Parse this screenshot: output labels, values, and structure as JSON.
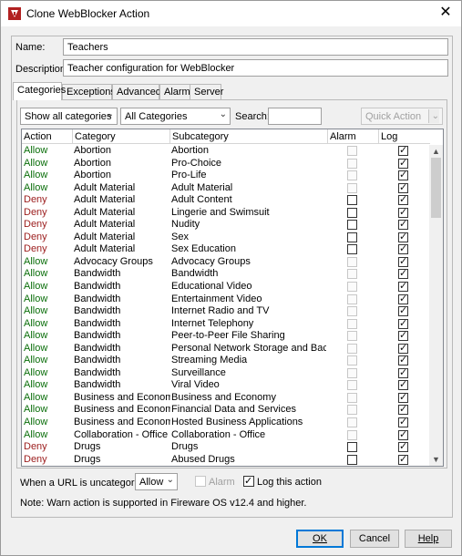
{
  "window": {
    "title": "Clone WebBlocker Action",
    "close_label": "✕"
  },
  "form": {
    "name_label": "Name:",
    "name_value": "Teachers",
    "description_label": "Description:",
    "description_value": "Teacher configuration for WebBlocker"
  },
  "tabs": [
    {
      "label": "Categories",
      "active": true
    },
    {
      "label": "Exceptions",
      "active": false
    },
    {
      "label": "Advanced",
      "active": false
    },
    {
      "label": "Alarm",
      "active": false
    },
    {
      "label": "Server",
      "active": false
    }
  ],
  "filters": {
    "show_select": "Show all categories",
    "category_select": "All Categories",
    "search_label": "Search:",
    "search_value": "",
    "quick_action": "Quick Action"
  },
  "table": {
    "headers": {
      "action": "Action",
      "category": "Category",
      "subcategory": "Subcategory",
      "alarm": "Alarm",
      "log": "Log"
    },
    "rows": [
      {
        "action": "Allow",
        "category": "Abortion",
        "subcategory": "Abortion",
        "alarm_enabled": false,
        "alarm": false,
        "log": true
      },
      {
        "action": "Allow",
        "category": "Abortion",
        "subcategory": "Pro-Choice",
        "alarm_enabled": false,
        "alarm": false,
        "log": true
      },
      {
        "action": "Allow",
        "category": "Abortion",
        "subcategory": "Pro-Life",
        "alarm_enabled": false,
        "alarm": false,
        "log": true
      },
      {
        "action": "Allow",
        "category": "Adult Material",
        "subcategory": "Adult Material",
        "alarm_enabled": false,
        "alarm": false,
        "log": true
      },
      {
        "action": "Deny",
        "category": "Adult Material",
        "subcategory": "Adult Content",
        "alarm_enabled": true,
        "alarm": false,
        "log": true
      },
      {
        "action": "Deny",
        "category": "Adult Material",
        "subcategory": "Lingerie and Swimsuit",
        "alarm_enabled": true,
        "alarm": false,
        "log": true
      },
      {
        "action": "Deny",
        "category": "Adult Material",
        "subcategory": "Nudity",
        "alarm_enabled": true,
        "alarm": false,
        "log": true
      },
      {
        "action": "Deny",
        "category": "Adult Material",
        "subcategory": "Sex",
        "alarm_enabled": true,
        "alarm": false,
        "log": true
      },
      {
        "action": "Deny",
        "category": "Adult Material",
        "subcategory": "Sex Education",
        "alarm_enabled": true,
        "alarm": false,
        "log": true
      },
      {
        "action": "Allow",
        "category": "Advocacy Groups",
        "subcategory": "Advocacy Groups",
        "alarm_enabled": false,
        "alarm": false,
        "log": true
      },
      {
        "action": "Allow",
        "category": "Bandwidth",
        "subcategory": "Bandwidth",
        "alarm_enabled": false,
        "alarm": false,
        "log": true
      },
      {
        "action": "Allow",
        "category": "Bandwidth",
        "subcategory": "Educational Video",
        "alarm_enabled": false,
        "alarm": false,
        "log": true
      },
      {
        "action": "Allow",
        "category": "Bandwidth",
        "subcategory": "Entertainment Video",
        "alarm_enabled": false,
        "alarm": false,
        "log": true
      },
      {
        "action": "Allow",
        "category": "Bandwidth",
        "subcategory": "Internet Radio and TV",
        "alarm_enabled": false,
        "alarm": false,
        "log": true
      },
      {
        "action": "Allow",
        "category": "Bandwidth",
        "subcategory": "Internet Telephony",
        "alarm_enabled": false,
        "alarm": false,
        "log": true
      },
      {
        "action": "Allow",
        "category": "Bandwidth",
        "subcategory": "Peer-to-Peer File Sharing",
        "alarm_enabled": false,
        "alarm": false,
        "log": true
      },
      {
        "action": "Allow",
        "category": "Bandwidth",
        "subcategory": "Personal Network Storage and Backup",
        "alarm_enabled": false,
        "alarm": false,
        "log": true
      },
      {
        "action": "Allow",
        "category": "Bandwidth",
        "subcategory": "Streaming Media",
        "alarm_enabled": false,
        "alarm": false,
        "log": true
      },
      {
        "action": "Allow",
        "category": "Bandwidth",
        "subcategory": "Surveillance",
        "alarm_enabled": false,
        "alarm": false,
        "log": true
      },
      {
        "action": "Allow",
        "category": "Bandwidth",
        "subcategory": "Viral Video",
        "alarm_enabled": false,
        "alarm": false,
        "log": true
      },
      {
        "action": "Allow",
        "category": "Business and Economy",
        "subcategory": "Business and Economy",
        "alarm_enabled": false,
        "alarm": false,
        "log": true
      },
      {
        "action": "Allow",
        "category": "Business and Economy",
        "subcategory": "Financial Data and Services",
        "alarm_enabled": false,
        "alarm": false,
        "log": true
      },
      {
        "action": "Allow",
        "category": "Business and Economy",
        "subcategory": "Hosted Business Applications",
        "alarm_enabled": false,
        "alarm": false,
        "log": true
      },
      {
        "action": "Allow",
        "category": "Collaboration - Office",
        "subcategory": "Collaboration - Office",
        "alarm_enabled": false,
        "alarm": false,
        "log": true
      },
      {
        "action": "Deny",
        "category": "Drugs",
        "subcategory": "Drugs",
        "alarm_enabled": true,
        "alarm": false,
        "log": true
      },
      {
        "action": "Deny",
        "category": "Drugs",
        "subcategory": "Abused Drugs",
        "alarm_enabled": true,
        "alarm": false,
        "log": true
      }
    ]
  },
  "uncategorized": {
    "label": "When a URL is uncategorized",
    "action_value": "Allow",
    "alarm_label": "Alarm",
    "alarm_checked": false,
    "log_label": "Log this action",
    "log_checked": true
  },
  "note": "Note: Warn action is supported in Fireware OS v12.4 and higher.",
  "buttons": {
    "ok": "OK",
    "cancel": "Cancel",
    "help": "Help"
  },
  "colors": {
    "allow": "#0a6e0a",
    "deny": "#9b1c1c",
    "app_icon": "#b22222"
  }
}
